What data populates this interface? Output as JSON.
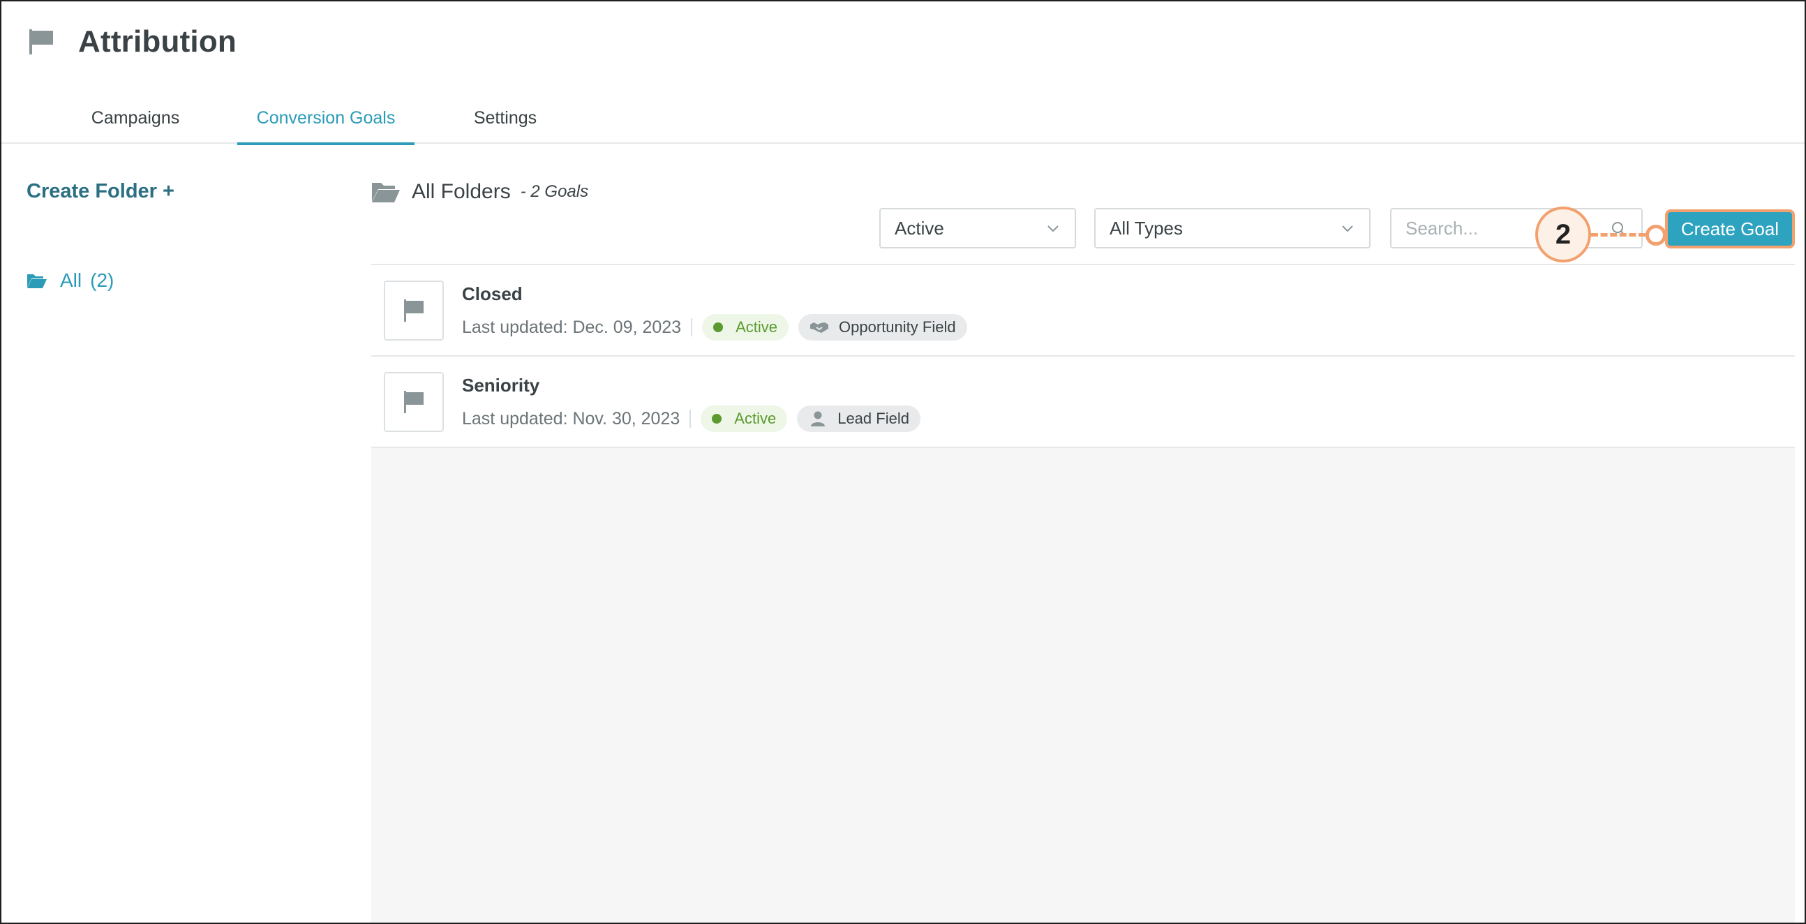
{
  "app": {
    "title": "Attribution",
    "icon": "flag-icon"
  },
  "tabs": [
    {
      "label": "Campaigns",
      "active": false
    },
    {
      "label": "Conversion Goals",
      "active": true
    },
    {
      "label": "Settings",
      "active": false
    }
  ],
  "sidebar": {
    "create_folder": "Create Folder +",
    "all_label": "All",
    "all_count": "(2)",
    "all_icon": "folder-open-icon"
  },
  "main": {
    "folder_title": "All Folders",
    "goal_count": "- 2 Goals",
    "folder_icon": "folder-open-icon",
    "filters": {
      "status": "Active",
      "type": "All Types"
    },
    "search": {
      "placeholder": "Search...",
      "value": ""
    },
    "create_goal": "Create Goal",
    "callout_number": "2"
  },
  "goals": [
    {
      "name": "Closed",
      "updated": "Last updated: Dec. 09, 2023",
      "status": "Active",
      "type": "Opportunity Field",
      "type_icon": "handshake-icon"
    },
    {
      "name": "Seniority",
      "updated": "Last updated: Nov. 30, 2023",
      "status": "Active",
      "type": "Lead Field",
      "type_icon": "person-icon"
    }
  ],
  "colors": {
    "accent": "#2b9bb8",
    "button": "#2ea3c0",
    "callout": "#f2a06e",
    "status_green": "#5a9a2e"
  }
}
